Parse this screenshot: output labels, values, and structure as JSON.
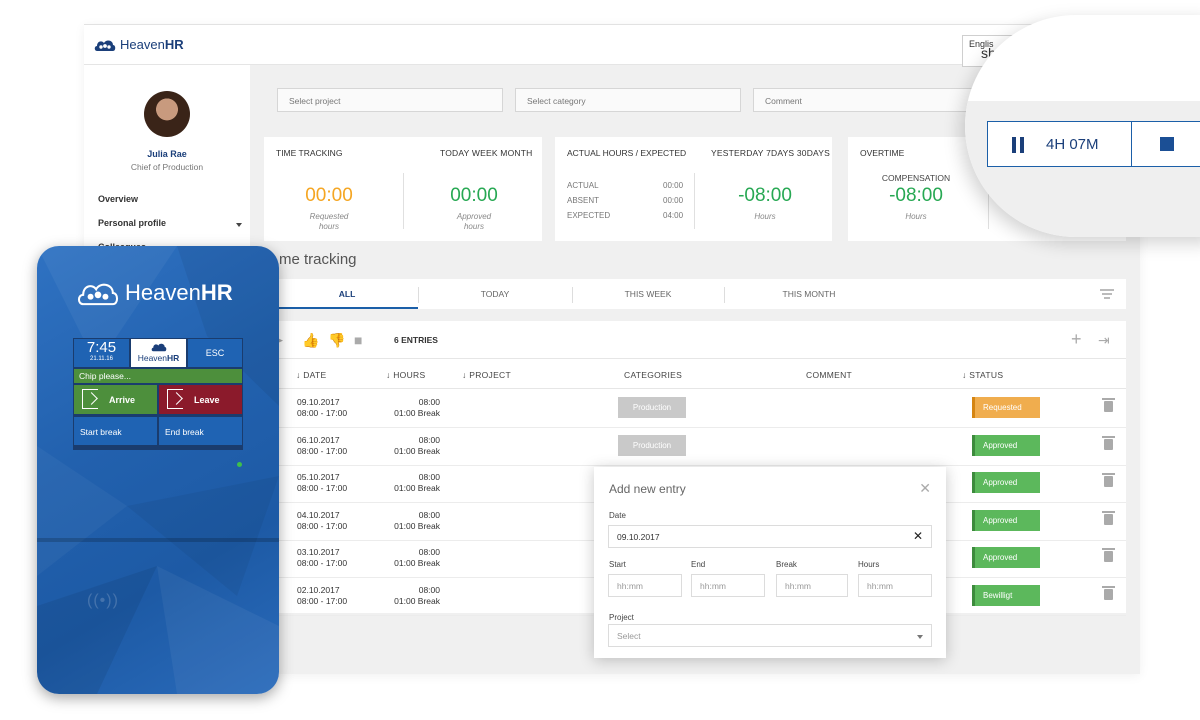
{
  "app": {
    "brand_light": "Heaven",
    "brand_bold": "HR",
    "language": {
      "label": "Englis",
      "selected": "sh"
    }
  },
  "sidebar": {
    "user": {
      "name": "Julia Rae",
      "role": "Chief of Production"
    },
    "items": [
      {
        "label": "Overview"
      },
      {
        "label": "Personal profile"
      },
      {
        "label": "Colleagues"
      }
    ]
  },
  "filters": {
    "project_placeholder": "Select project",
    "category_placeholder": "Select category",
    "comment_placeholder": "Comment"
  },
  "cards": {
    "time_tracking": {
      "title": "TIME TRACKING",
      "periods": "TODAY  WEEK  MONTH",
      "requested_value": "00:00",
      "requested_label_1": "Requested",
      "requested_label_2": "hours",
      "approved_value": "00:00",
      "approved_label_1": "Approved",
      "approved_label_2": "hours"
    },
    "actual_hours": {
      "title": "ACTUAL HOURS / EXPECTED",
      "periods": "YESTERDAY  7DAYS  30DAYS",
      "rows": [
        {
          "label": "ACTUAL",
          "value": "00:00"
        },
        {
          "label": "ABSENT",
          "value": "00:00"
        },
        {
          "label": "EXPECTED",
          "value": "04:00"
        }
      ],
      "value": "-08:00",
      "value_label": "Hours"
    },
    "overtime": {
      "title": "OVERTIME",
      "compensation_label": "COMPENSATION",
      "value": "-08:00",
      "value_label": "Hours"
    }
  },
  "section_title": "me tracking",
  "tabs": [
    {
      "label": "ALL",
      "active": true
    },
    {
      "label": "TODAY"
    },
    {
      "label": "THIS WEEK"
    },
    {
      "label": "THIS MONTH"
    }
  ],
  "table": {
    "entries_label": "6 ENTRIES",
    "headers": {
      "date": "DATE",
      "hours": "HOURS",
      "project": "PROJECT",
      "categories": "CATEGORIES",
      "comment": "COMMENT",
      "status": "STATUS"
    },
    "rows": [
      {
        "date": "09.10.2017",
        "time": "08:00 - 17:00",
        "hours": "08:00",
        "break": "01:00 Break",
        "category": "Production",
        "status": "Requested"
      },
      {
        "date": "06.10.2017",
        "time": "08:00 - 17:00",
        "hours": "08:00",
        "break": "01:00 Break",
        "category": "Production",
        "status": "Approved"
      },
      {
        "date": "05.10.2017",
        "time": "08:00 - 17:00",
        "hours": "08:00",
        "break": "01:00 Break",
        "category": "",
        "status": "Approved"
      },
      {
        "date": "04.10.2017",
        "time": "08:00 - 17:00",
        "hours": "08:00",
        "break": "01:00 Break",
        "category": "",
        "status": "Approved"
      },
      {
        "date": "03.10.2017",
        "time": "08:00 - 17:00",
        "hours": "08:00",
        "break": "01:00 Break",
        "category": "",
        "status": "Approved"
      },
      {
        "date": "02.10.2017",
        "time": "08:00 - 17:00",
        "hours": "08:00",
        "break": "01:00 Break",
        "category": "",
        "status": "Bewilligt"
      }
    ]
  },
  "modal": {
    "title": "Add new entry",
    "date_label": "Date",
    "date_value": "09.10.2017",
    "start_label": "Start",
    "end_label": "End",
    "break_label": "Break",
    "hours_label": "Hours",
    "time_placeholder": "hh:mm",
    "project_label": "Project",
    "project_placeholder": "Select"
  },
  "timer": {
    "elapsed": "4H 07M"
  },
  "terminal": {
    "brand_light": "Heaven",
    "brand_bold": "HR",
    "clock_time": "7:45",
    "clock_date": "21.11.16",
    "screen_logo_light": "Heaven",
    "screen_logo_bold": "HR",
    "esc_label": "ESC",
    "chip_prompt": "Chip please...",
    "arrive_label": "Arrive",
    "leave_label": "Leave",
    "start_break_label": "Start break",
    "end_break_label": "End break"
  },
  "colors": {
    "brand_blue": "#1b3f7a",
    "accent_blue": "#1b5fa8",
    "requested_orange": "#f0ad4e",
    "approved_green": "#5cb85c",
    "timer_orange": "#f5a623",
    "value_green": "#27a853",
    "arrive_green": "#4d8f3c",
    "leave_red": "#8b1a2b"
  },
  "icons": {
    "favorite": "heart-icon",
    "help": "help-icon",
    "settings": "gear-icon"
  }
}
